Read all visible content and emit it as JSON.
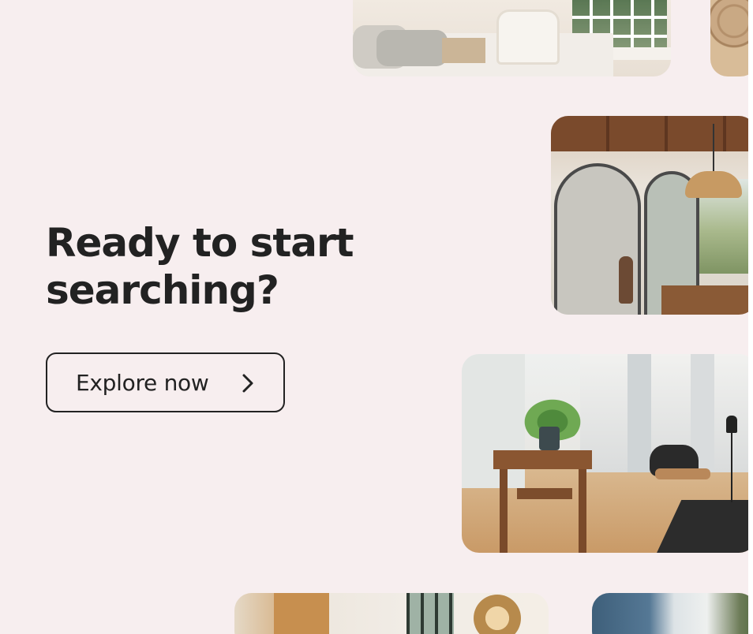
{
  "hero": {
    "headline_line1": "Ready to start",
    "headline_line2": "searching?",
    "cta_label": "Explore now"
  },
  "icons": {
    "cta_icon": "chevron-right-icon"
  },
  "colors": {
    "background": "#f7eeef",
    "text": "#222222",
    "button_border": "#222222"
  },
  "photos": [
    {
      "name": "bedroom-photo"
    },
    {
      "name": "wicker-decor-photo"
    },
    {
      "name": "arched-kitchen-photo"
    },
    {
      "name": "city-dining-room-photo"
    },
    {
      "name": "living-room-photo"
    },
    {
      "name": "blue-cabinet-photo"
    }
  ]
}
